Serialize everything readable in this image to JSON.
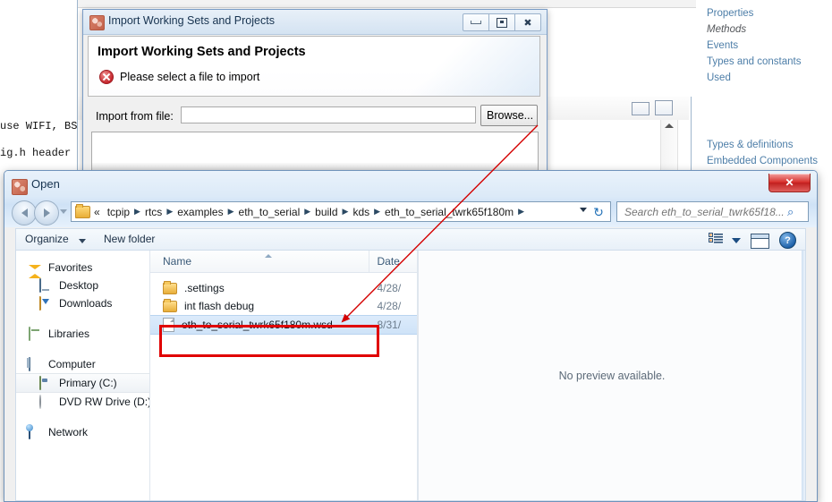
{
  "background": {
    "code_lines": [
      "use WIFI, BSP",
      "ig.h header f"
    ],
    "right_links": [
      {
        "label": "Properties",
        "style": "normal"
      },
      {
        "label": "Methods",
        "style": "italic"
      },
      {
        "label": "Events",
        "style": "normal"
      },
      {
        "label": "Types and constants",
        "style": "normal"
      },
      {
        "label": "Used",
        "style": "normal"
      }
    ],
    "right_links_2": [
      {
        "label": "Types & definitions",
        "style": "normal"
      },
      {
        "label": "Embedded Components",
        "style": "normal"
      }
    ]
  },
  "import_dialog": {
    "window_title": "Import Working Sets and Projects",
    "header_title": "Import Working Sets and Projects",
    "error_message": "Please select a file to import",
    "file_label": "Import from file:",
    "file_value": "",
    "file_placeholder": "",
    "browse_label": "Browse...",
    "minimize_title": "Minimize",
    "maximize_title": "Maximize",
    "close_glyph": "✖"
  },
  "open_dialog": {
    "window_title": "Open",
    "close_glyph": "✕",
    "breadcrumbs": [
      "«",
      "tcpip",
      "rtcs",
      "examples",
      "eth_to_serial",
      "build",
      "kds",
      "eth_to_serial_twrk65f180m"
    ],
    "crumb_separator": "▶",
    "refresh_glyph": "↻",
    "search_placeholder": "Search eth_to_serial_twrk65f18...",
    "search_value": "",
    "search_glyph": "⌕",
    "toolbar": {
      "organize_label": "Organize",
      "new_folder_label": "New folder",
      "help_glyph": "?"
    },
    "nav_pane": [
      {
        "label": "Favorites",
        "icon": "star-icon",
        "level": "root",
        "selected": false
      },
      {
        "label": "Desktop",
        "icon": "desktop-icon",
        "level": "child",
        "selected": false
      },
      {
        "label": "Downloads",
        "icon": "downloads-icon",
        "level": "child",
        "selected": false
      },
      {
        "label": "Libraries",
        "icon": "libraries-icon",
        "level": "root",
        "selected": false
      },
      {
        "label": "Computer",
        "icon": "computer-icon",
        "level": "root",
        "selected": false
      },
      {
        "label": "Primary (C:)",
        "icon": "hard-drive-icon",
        "level": "child",
        "selected": true
      },
      {
        "label": "DVD RW Drive (D:) G",
        "icon": "dvd-drive-icon",
        "level": "child",
        "selected": false
      },
      {
        "label": "Network",
        "icon": "network-icon",
        "level": "root",
        "selected": false
      }
    ],
    "columns": {
      "name": "Name",
      "date": "Date"
    },
    "files": [
      {
        "name": ".settings",
        "date": "4/28/",
        "type": "folder",
        "selected": false
      },
      {
        "name": "int flash debug",
        "date": "4/28/",
        "type": "folder",
        "selected": false
      },
      {
        "name": "eth_to_serial_twrk65f180m.wsd",
        "date": "8/31/",
        "type": "file",
        "selected": true
      }
    ],
    "preview_text": "No preview available."
  },
  "annotations": {
    "highlight_color": "#e00000",
    "arrow_color": "#d40000"
  }
}
